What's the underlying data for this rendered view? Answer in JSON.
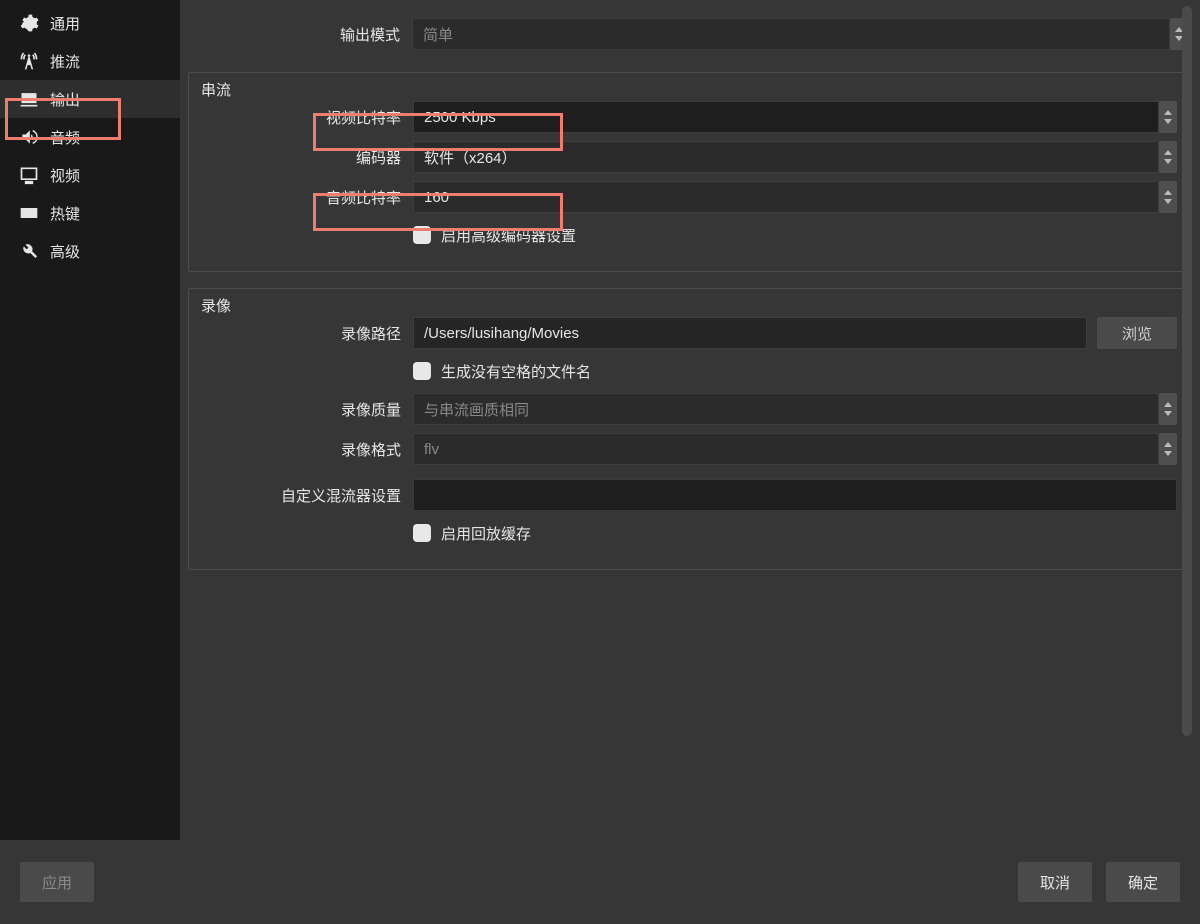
{
  "sidebar": {
    "items": [
      {
        "label": "通用"
      },
      {
        "label": "推流"
      },
      {
        "label": "输出",
        "selected": true
      },
      {
        "label": "音频"
      },
      {
        "label": "视频"
      },
      {
        "label": "热键"
      },
      {
        "label": "高级"
      }
    ]
  },
  "top": {
    "output_mode_label": "输出模式",
    "output_mode_value": "简单"
  },
  "stream": {
    "legend": "串流",
    "video_bitrate_label": "视频比特率",
    "video_bitrate_value": "2500 Kbps",
    "encoder_label": "编码器",
    "encoder_value": "软件（x264）",
    "audio_bitrate_label": "音频比特率",
    "audio_bitrate_value": "160",
    "adv_checkbox_label": "启用高级编码器设置"
  },
  "record": {
    "legend": "录像",
    "path_label": "录像路径",
    "path_value": "/Users/lusihang/Movies",
    "browse_label": "浏览",
    "nospace_checkbox_label": "生成没有空格的文件名",
    "quality_label": "录像质量",
    "quality_value": "与串流画质相同",
    "format_label": "录像格式",
    "format_value": "flv",
    "muxer_label": "自定义混流器设置",
    "muxer_value": "",
    "replay_checkbox_label": "启用回放缓存"
  },
  "buttons": {
    "apply": "应用",
    "cancel": "取消",
    "ok": "确定"
  }
}
